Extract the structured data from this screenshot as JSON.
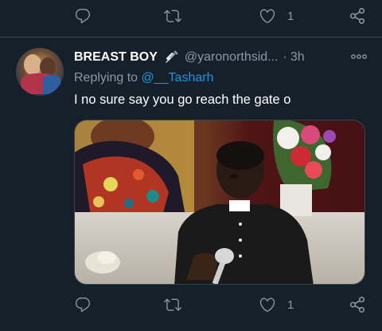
{
  "top_actions": {
    "like_count": "1"
  },
  "tweet": {
    "author_name": "BREAST BOY",
    "author_emoji": "syringe-emoji",
    "handle": "@yaronorthsid...",
    "separator": "·",
    "time": "3h",
    "replying_label": "Replying to",
    "replying_to": "@__Tasharh",
    "text": "I no sure say you go reach the gate o",
    "media": "video-frame-boy-with-microphone"
  },
  "bottom_actions": {
    "like_count": "1"
  },
  "icons": {
    "reply": "reply-icon",
    "retweet": "retweet-icon",
    "like": "heart-icon",
    "share": "share-icon",
    "more": "more-icon"
  },
  "colors": {
    "background": "#15202b",
    "secondary_text": "#8899a6",
    "link": "#1b95e0",
    "divider": "#38444d"
  }
}
